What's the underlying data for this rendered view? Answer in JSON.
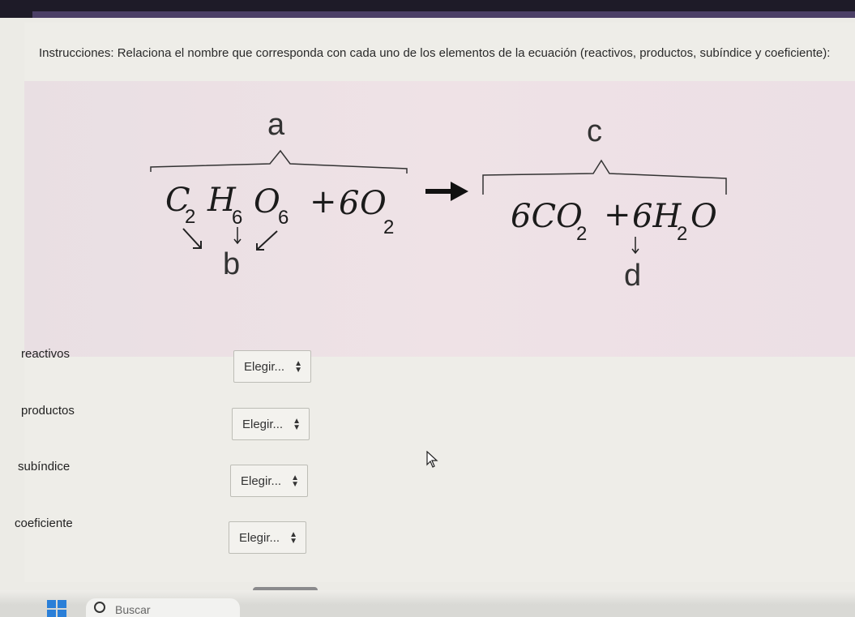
{
  "instructions": "Instrucciones: Relaciona el nombre que corresponda con cada uno de los elementos de la ecuación (reactivos, productos, subíndice y coeficiente):",
  "equation": {
    "letters": {
      "a": "a",
      "b": "b",
      "c": "c",
      "d": "d"
    },
    "left": {
      "C": "C",
      "c_sub": "2",
      "H": "H",
      "h_sub": "6",
      "O": "O",
      "o_sub": "6",
      "plus": "+",
      "six": "6",
      "O2": "O",
      "o2_sub": "2"
    },
    "right": {
      "six_co2": "6CO",
      "co2_sub": "2",
      "plus": "+",
      "six_h2o": "6H",
      "h2o_sub": "2",
      "o": "O"
    }
  },
  "matching": {
    "rows": [
      {
        "label": "reactivos",
        "selected": "Elegir..."
      },
      {
        "label": "productos",
        "selected": "Elegir..."
      },
      {
        "label": "subíndice",
        "selected": "Elegir..."
      },
      {
        "label": "coeficiente",
        "selected": "Elegir..."
      }
    ]
  },
  "taskbar": {
    "search_placeholder": "Buscar"
  },
  "colors": {
    "arrow": "#111111",
    "select_border": "#bdbdb6",
    "start_icon": "#2a7fd8"
  }
}
